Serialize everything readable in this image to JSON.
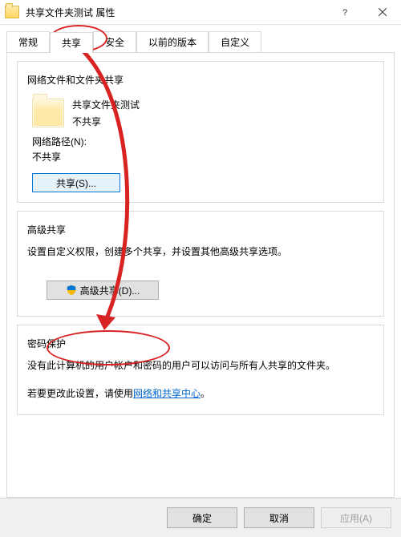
{
  "window": {
    "title": "共享文件夹测试 属性"
  },
  "tabs": {
    "general": "常规",
    "sharing": "共享",
    "security": "安全",
    "previous": "以前的版本",
    "custom": "自定义"
  },
  "network_share": {
    "group_title": "网络文件和文件夹共享",
    "folder_name": "共享文件夹测试",
    "share_status": "不共享",
    "path_label": "网络路径(N):",
    "path_value": "不共享",
    "share_button": "共享(S)..."
  },
  "advanced_share": {
    "group_title": "高级共享",
    "description": "设置自定义权限，创建多个共享，并设置其他高级共享选项。",
    "button": "高级共享(D)..."
  },
  "password": {
    "group_title": "密码保护",
    "line1": "没有此计算机的用户帐户和密码的用户可以访问与所有人共享的文件夹。",
    "line2_prefix": "若要更改此设置，请使用",
    "line2_link": "网络和共享中心",
    "line2_suffix": "。"
  },
  "buttons": {
    "ok": "确定",
    "cancel": "取消",
    "apply": "应用(A)"
  }
}
